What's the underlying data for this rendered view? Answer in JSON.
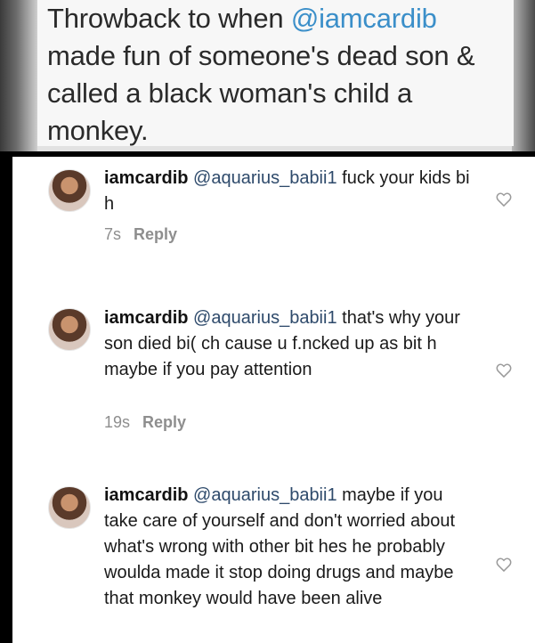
{
  "caption": {
    "lead": "Throwback to when ",
    "mention": "@iamcardib",
    "rest": " made fun of someone's dead son & called a black woman's child a monkey."
  },
  "comments": [
    {
      "username": "iamcardib",
      "mention": "@aquarius_babii1",
      "text": "fuck your kids bi  h",
      "time": "7s",
      "reply_label": "Reply"
    },
    {
      "username": "iamcardib",
      "mention": "@aquarius_babii1",
      "text": "that's why your son died bi( ch cause u f.ncked up as bit h maybe if you pay attention",
      "time": "19s",
      "reply_label": "Reply"
    },
    {
      "username": "iamcardib",
      "mention": "@aquarius_babii1",
      "text": "maybe if you take care of yourself and don't worried about what's wrong with other bit hes he probably woulda made it stop doing drugs and maybe that monkey would have been alive"
    }
  ],
  "icons": {
    "avatar": "profile-avatar",
    "like": "heart-outline-icon"
  }
}
